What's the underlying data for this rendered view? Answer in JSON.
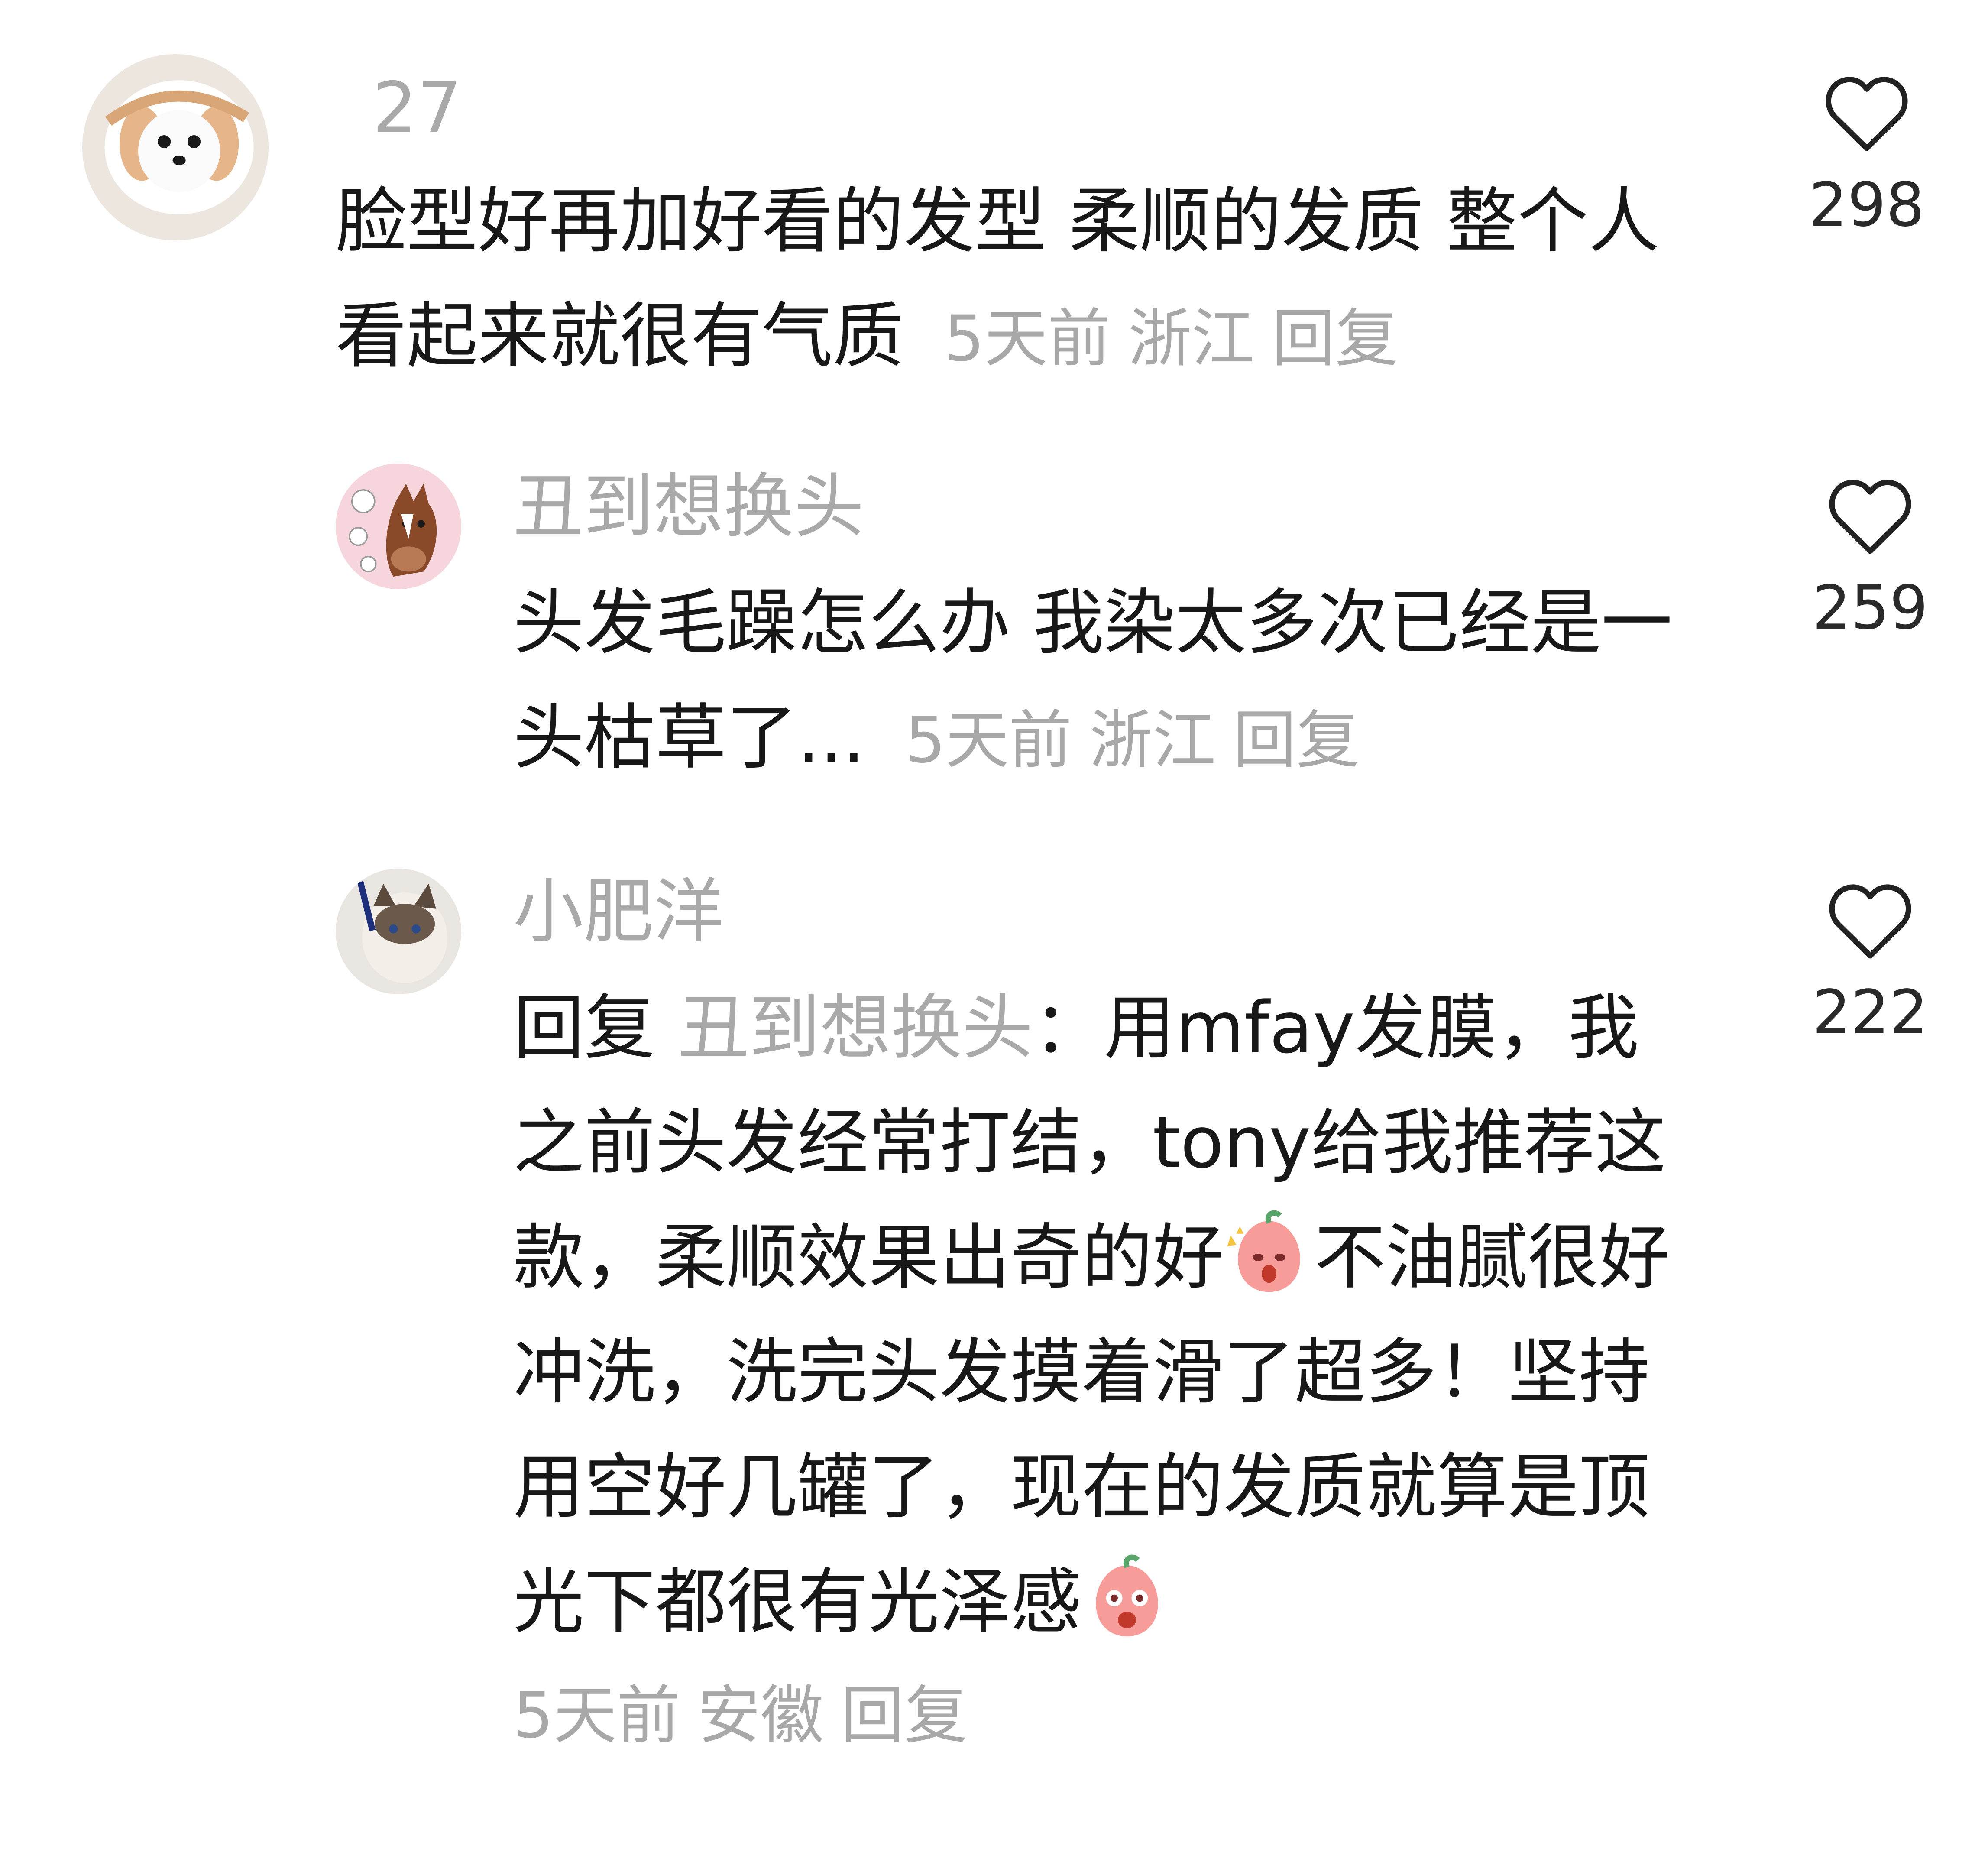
{
  "comments": [
    {
      "username": "27",
      "text": "脸型好再加好看的发型 柔顺的发质 整个人看起来就很有气质",
      "time": "5天前",
      "location": "浙江",
      "reply_label": "回复",
      "likes": "298",
      "avatar_icon": "white-dog-avatar"
    },
    {
      "username": "丑到想换头",
      "text": "头发毛躁怎么办 我染太多次已经是一头枯草了...",
      "time": "5天前",
      "location": "浙江",
      "reply_label": "回复",
      "likes": "259",
      "avatar_icon": "cartoon-horse-avatar"
    },
    {
      "username": "小肥洋",
      "reply_prefix": "回复",
      "reply_to": "丑到想换头",
      "reply_colon": "：",
      "text_part1": "用mfay发膜，我之前头发经常打结，tony给我推荐这款，柔顺效果出奇的好",
      "text_part2": "不油腻很好冲洗，洗完头发摸着滑了超多！坚持用空好几罐了，现在的发质就算是顶光下都很有光泽感",
      "emoji1": "excited-peach-emoji",
      "emoji2": "surprised-peach-emoji",
      "time": "5天前",
      "location": "安徽",
      "reply_label": "回复",
      "likes": "222",
      "avatar_icon": "ragdoll-cat-avatar"
    }
  ],
  "colors": {
    "text": "#181818",
    "meta": "#a8a8a8",
    "username": "#a9a9a9",
    "icon": "#222222"
  }
}
